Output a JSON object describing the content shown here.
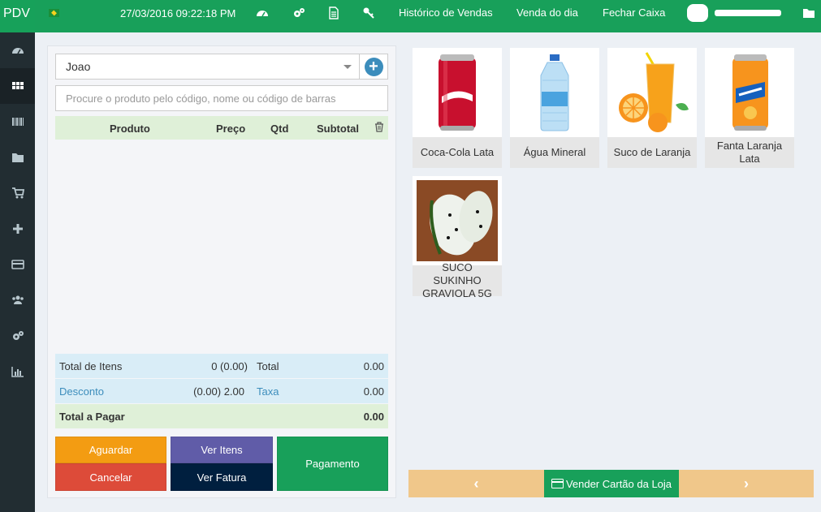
{
  "topbar": {
    "brand": "PDV",
    "datetime": "27/03/2016 09:22:18 PM",
    "links": [
      "Histórico de Vendas",
      "Venda do dia",
      "Fechar Caixa"
    ]
  },
  "customer": {
    "selected": "Joao"
  },
  "search": {
    "placeholder": "Procure o produto pelo código, nome ou código de barras"
  },
  "table": {
    "headers": [
      "Produto",
      "Preço",
      "Qtd",
      "Subtotal"
    ]
  },
  "totals": {
    "items_label": "Total de Itens",
    "items_value": "0 (0.00)",
    "total_label": "Total",
    "total_value": "0.00",
    "discount_label": "Desconto",
    "discount_value": "(0.00) 2.00",
    "tax_label": "Taxa",
    "tax_value": "0.00",
    "pay_label": "Total a Pagar",
    "pay_value": "0.00"
  },
  "actions": {
    "hold": "Aguardar",
    "view_items": "Ver Itens",
    "payment": "Pagamento",
    "cancel": "Cancelar",
    "view_invoice": "Ver Fatura"
  },
  "products": [
    {
      "name": "Coca-Cola Lata"
    },
    {
      "name": "Água Mineral"
    },
    {
      "name": "Suco de Laranja"
    },
    {
      "name": "Fanta Laranja Lata"
    },
    {
      "name": "SUCO SUKINHO GRAVIOLA 5G"
    }
  ],
  "nav": {
    "prev": "‹",
    "center": "Vender Cartão da Loja",
    "next": "›"
  },
  "colors": {
    "green": "#18a05a",
    "sidebar": "#222d32",
    "orange": "#f39c12",
    "purple": "#605ca8",
    "red": "#dd4b39",
    "navy": "#001f3f",
    "pager": "#f0c78a"
  }
}
